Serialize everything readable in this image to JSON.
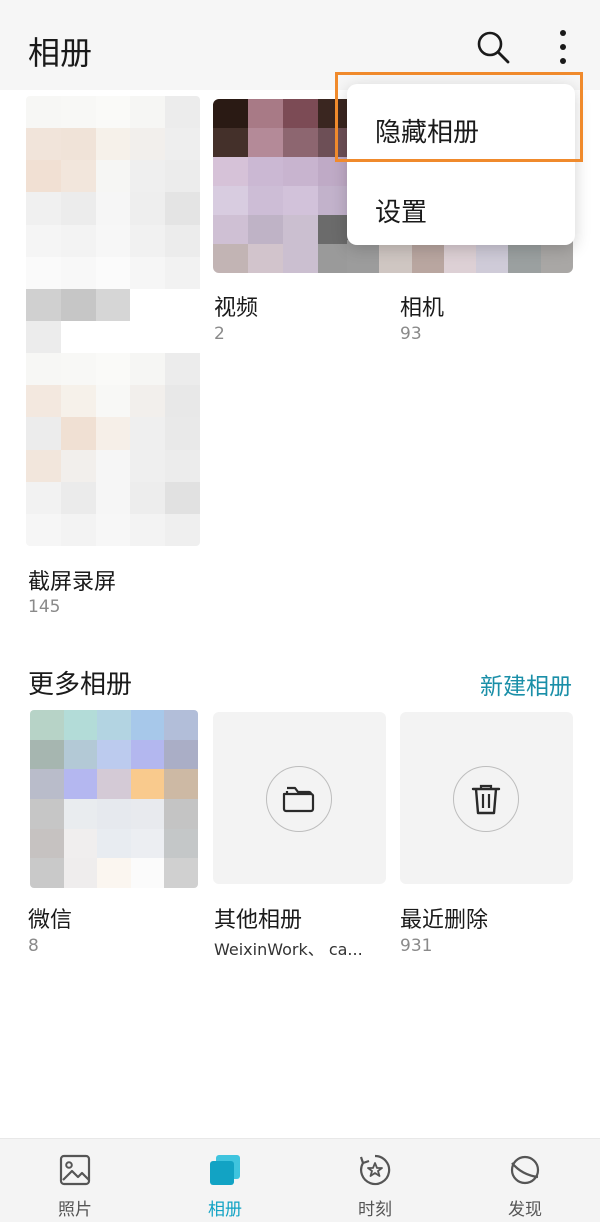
{
  "header": {
    "title": "相册"
  },
  "albums": [
    {
      "label": "视频",
      "count": "2"
    },
    {
      "label": "相机",
      "count": "93"
    },
    {
      "label": "截屏录屏",
      "count": "145"
    }
  ],
  "more": {
    "title": "更多相册",
    "new_label": "新建相册",
    "cards": [
      {
        "label": "微信",
        "count": "8"
      },
      {
        "label": "其他相册",
        "count": "WeixinWork、 ca..."
      },
      {
        "label": "最近删除",
        "count": "931"
      }
    ]
  },
  "menu": {
    "items": [
      "隐藏相册",
      "设置"
    ]
  },
  "nav": [
    {
      "label": "照片",
      "icon": "photo-icon"
    },
    {
      "label": "相册",
      "icon": "album-icon"
    },
    {
      "label": "时刻",
      "icon": "moments-icon"
    },
    {
      "label": "发现",
      "icon": "discover-icon"
    }
  ],
  "colors": {
    "accent": "#12a3c4",
    "link": "#1a8fa8",
    "highlight_border": "#f08a2c"
  }
}
